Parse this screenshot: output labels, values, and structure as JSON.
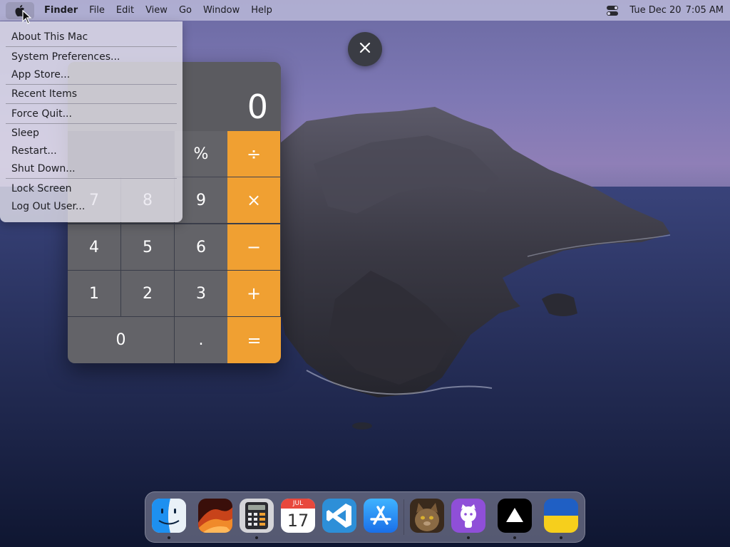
{
  "menubar": {
    "apple_icon": "apple-logo-icon",
    "app_name": "Finder",
    "menus": [
      "File",
      "Edit",
      "View",
      "Go",
      "Window",
      "Help"
    ],
    "control_center_icon": "control-center-icon",
    "date": "Tue Dec 20",
    "time": "7:05 AM"
  },
  "apple_menu": {
    "items": [
      "About This Mac",
      "System Preferences...",
      "App Store...",
      "Recent Items",
      "Force Quit...",
      "Sleep",
      "Restart...",
      "Shut Down...",
      "Lock Screen",
      "Log Out User..."
    ]
  },
  "calculator": {
    "display": "0",
    "keys": {
      "percent": "%",
      "divide": "÷",
      "seven": "7",
      "eight": "8",
      "nine": "9",
      "multiply": "×",
      "four": "4",
      "five": "5",
      "six": "6",
      "minus": "−",
      "one": "1",
      "two": "2",
      "three": "3",
      "plus": "+",
      "zero": "0",
      "decimal": ".",
      "equals": "="
    },
    "close_icon": "close-icon"
  },
  "dock": {
    "apps": [
      "finder",
      "macos-ventura-wallpaper",
      "calculator",
      "calendar",
      "visual-studio-code",
      "app-store",
      "cat-photo",
      "github",
      "vercel",
      "ukraine-flag"
    ],
    "calendar_month": "JUL",
    "calendar_day": "17"
  },
  "colors": {
    "accent_orange": "#f0a032",
    "key_gray": "#636368",
    "menubar_bg": "#c8c6e2"
  }
}
